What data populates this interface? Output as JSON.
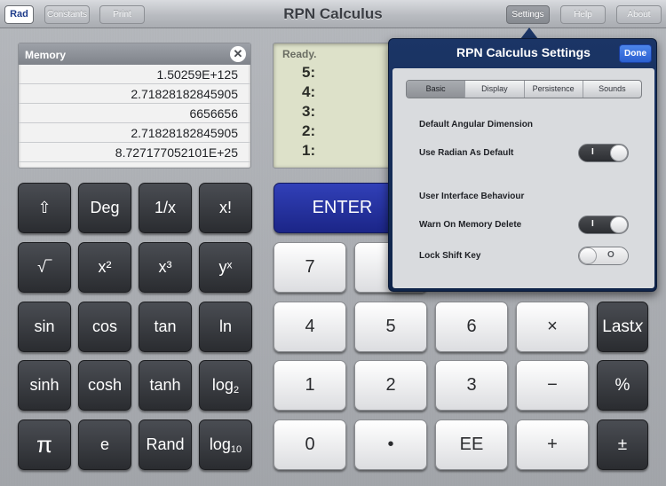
{
  "header": {
    "mode": "Rad",
    "constants": "Constants",
    "print": "Print",
    "title": "RPN Calculus",
    "settings": "Settings",
    "help": "Help",
    "about": "About"
  },
  "memory": {
    "title": "Memory",
    "close_icon": "close-icon",
    "values": [
      "1.50259E+125",
      "2.71828182845905",
      "6656656",
      "2.71828182845905",
      "8.727177052101E+25"
    ]
  },
  "stack": {
    "status": "Ready.",
    "registers": [
      "5:",
      "4:",
      "3:",
      "2:",
      "1:"
    ]
  },
  "function_keys": [
    [
      "⇧",
      "Deg",
      "1/x",
      "x!"
    ],
    [
      "√‾",
      "x²",
      "x³",
      "yˣ"
    ],
    [
      "sin",
      "cos",
      "tan",
      "ln"
    ],
    [
      "sinh",
      "cosh",
      "tanh",
      "log",
      "2"
    ],
    [
      "π",
      "e",
      "Rand",
      "log",
      "10"
    ]
  ],
  "keypad": {
    "enter": "ENTER",
    "row1": [
      "7"
    ],
    "row2": [
      "4",
      "5",
      "6",
      "×"
    ],
    "row3": [
      "1",
      "2",
      "3",
      "−"
    ],
    "row4": [
      "0",
      "•",
      "EE",
      "+"
    ],
    "right": [
      "Last",
      "x",
      "%",
      "±"
    ]
  },
  "settings": {
    "title": "RPN Calculus Settings",
    "done": "Done",
    "tabs": [
      "Basic",
      "Display",
      "Persistence",
      "Sounds"
    ],
    "selected_tab": "Basic",
    "section1": "Default Angular Dimension",
    "use_radian": "Use Radian As Default",
    "use_radian_on": true,
    "section2": "User Interface Behaviour",
    "warn_delete": "Warn On Memory Delete",
    "warn_delete_on": true,
    "lock_shift": "Lock Shift Key",
    "lock_shift_on": false,
    "on_mark": "I",
    "off_mark": "O"
  },
  "colors": {
    "enter": "#1b2587",
    "popover": "#1b3566",
    "done": "#2a5fd0",
    "stack_lcd": "#dde1c9"
  }
}
